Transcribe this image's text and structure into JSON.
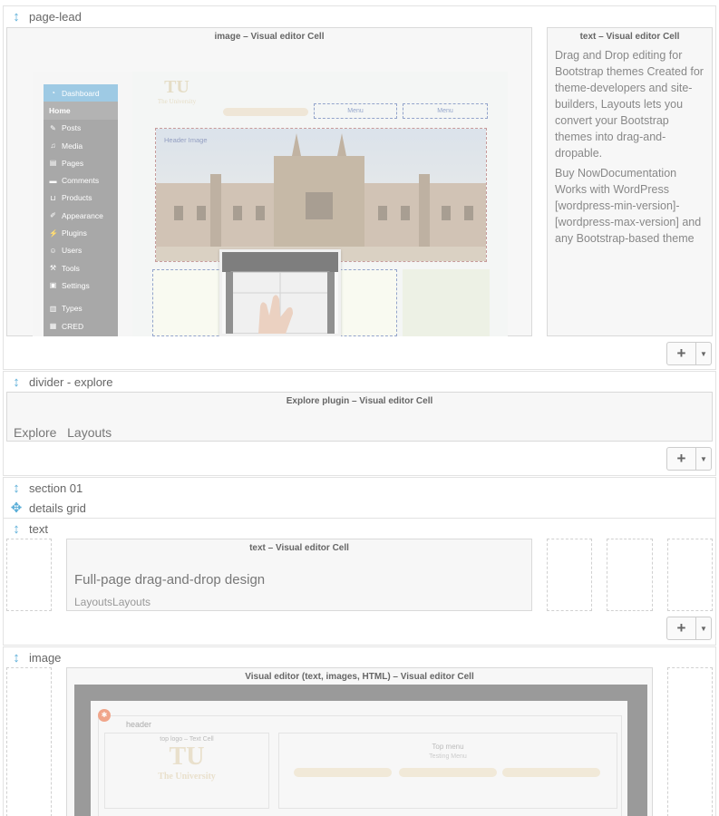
{
  "rows": [
    {
      "name": "page-lead"
    },
    {
      "name": "divider - explore"
    },
    {
      "name": "section 01"
    },
    {
      "name": "details grid"
    },
    {
      "name": "text"
    },
    {
      "name": "image"
    }
  ],
  "cells": {
    "lead_image_title": "image – Visual editor Cell",
    "lead_text_title": "text – Visual editor Cell",
    "lead_text_p1": "Drag and Drop editing for Bootstrap themes Created for theme-developers and site-builders, Layouts lets you convert your Bootstrap themes into drag-and-dropable.",
    "lead_text_p2": "Buy NowDocumentation Works with WordPress [wordpress-min-version]-[wordpress-max-version] and any Bootstrap-based theme",
    "explore_title": "Explore plugin – Visual editor Cell",
    "explore_text": "Explore   Layouts",
    "text_title": "text – Visual editor Cell",
    "text_heading": "Full-page drag-and-drop design",
    "text_sub": "LayoutsLayouts",
    "image_title": "Visual editor (text, images, HTML) – Visual editor Cell"
  },
  "preview_wp": {
    "menu": [
      {
        "label": "Dashboard",
        "icon": "dashboard-icon"
      },
      {
        "label": "Home",
        "icon": ""
      },
      {
        "label": "Posts",
        "icon": "pin-icon"
      },
      {
        "label": "Media",
        "icon": "media-icon"
      },
      {
        "label": "Pages",
        "icon": "pages-icon"
      },
      {
        "label": "Comments",
        "icon": "comments-icon"
      },
      {
        "label": "Products",
        "icon": "cart-icon"
      },
      {
        "label": "Appearance",
        "icon": "brush-icon"
      },
      {
        "label": "Plugins",
        "icon": "plug-icon"
      },
      {
        "label": "Users",
        "icon": "user-icon"
      },
      {
        "label": "Tools",
        "icon": "wrench-icon"
      },
      {
        "label": "Settings",
        "icon": "settings-icon"
      },
      {
        "label": "Types",
        "icon": "types-icon"
      },
      {
        "label": "CRED",
        "icon": "cred-icon"
      }
    ],
    "logo_text": "TU",
    "logo_sub": "The University",
    "menu_btn_1": "Menu",
    "menu_btn_2": "Menu",
    "header_image_label": "Header Image"
  },
  "preview_layout": {
    "header_label": "header",
    "logo_cell_title": "top logo – Text Cell",
    "logo_text": "TU",
    "logo_sub": "The University",
    "top_menu_title": "Top menu",
    "top_menu_sub": "Testing Menu"
  },
  "add_button": {
    "plus": "+",
    "caret": "▼"
  },
  "colors": {
    "accent": "#5aaed8",
    "wp_highlight": "#6aaed6"
  }
}
